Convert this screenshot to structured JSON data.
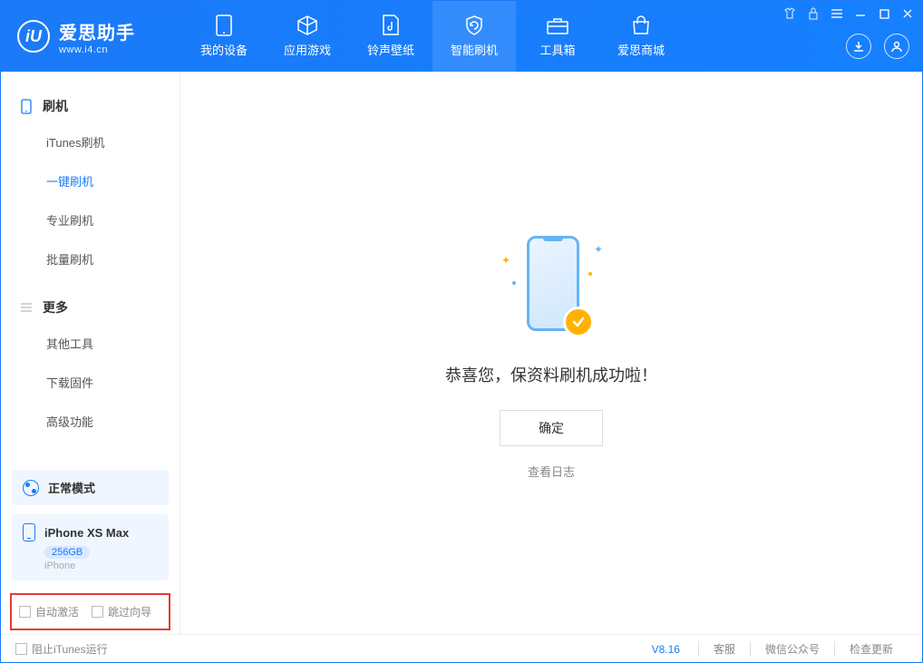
{
  "app": {
    "title": "爱思助手",
    "subtitle": "www.i4.cn"
  },
  "nav": [
    {
      "label": "我的设备"
    },
    {
      "label": "应用游戏"
    },
    {
      "label": "铃声壁纸"
    },
    {
      "label": "智能刷机"
    },
    {
      "label": "工具箱"
    },
    {
      "label": "爱思商城"
    }
  ],
  "sidebar": {
    "section1": {
      "title": "刷机",
      "items": [
        "iTunes刷机",
        "一键刷机",
        "专业刷机",
        "批量刷机"
      ]
    },
    "section2": {
      "title": "更多",
      "items": [
        "其他工具",
        "下载固件",
        "高级功能"
      ]
    }
  },
  "mode": {
    "label": "正常模式"
  },
  "device": {
    "name": "iPhone XS Max",
    "storage": "256GB",
    "type": "iPhone"
  },
  "options": {
    "autoActivate": "自动激活",
    "skipGuide": "跳过向导"
  },
  "main": {
    "success": "恭喜您，保资料刷机成功啦！",
    "ok": "确定",
    "viewLog": "查看日志"
  },
  "footer": {
    "blockItunes": "阻止iTunes运行",
    "version": "V8.16",
    "links": [
      "客服",
      "微信公众号",
      "检查更新"
    ]
  }
}
